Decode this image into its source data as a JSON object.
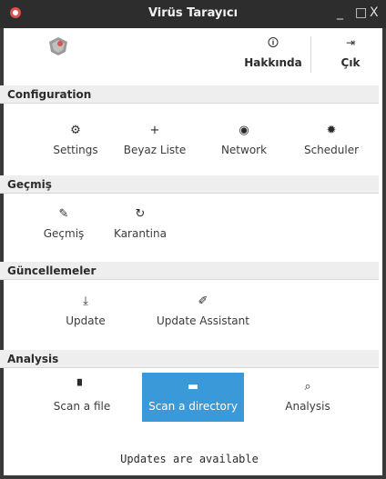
{
  "window": {
    "title": "Virüs Tarayıcı",
    "min": "_",
    "max": "□",
    "close": "X"
  },
  "header": {
    "about_icon": "info-icon",
    "about_label": "Hakkında",
    "exit_icon": "sign-out-icon",
    "exit_label": "Çık"
  },
  "sections": {
    "configuration": {
      "title": "Configuration",
      "items": [
        {
          "label": "Settings",
          "icon": "gears-icon"
        },
        {
          "label": "Beyaz Liste",
          "icon": "plus-icon"
        },
        {
          "label": "Network",
          "icon": "globe-icon"
        },
        {
          "label": "Scheduler",
          "icon": "gear-icon"
        }
      ]
    },
    "history": {
      "title": "Geçmiş",
      "items": [
        {
          "label": "Geçmiş",
          "icon": "pencil-icon"
        },
        {
          "label": "Karantina",
          "icon": "refresh-icon"
        }
      ]
    },
    "updates": {
      "title": "Güncellemeler",
      "items": [
        {
          "label": "Update",
          "icon": "download-icon"
        },
        {
          "label": "Update Assistant",
          "icon": "eyedropper-icon"
        }
      ]
    },
    "analysis": {
      "title": "Analysis",
      "items": [
        {
          "label": "Scan a file",
          "icon": "file-icon"
        },
        {
          "label": "Scan a directory",
          "icon": "folder-icon",
          "selected": true
        },
        {
          "label": "Analysis",
          "icon": "search-icon"
        }
      ]
    }
  },
  "status": "Updates are available",
  "colors": {
    "titlebar": "#2d2d2d",
    "accent": "#3a9ad9",
    "section_bg": "#eeeeee"
  }
}
